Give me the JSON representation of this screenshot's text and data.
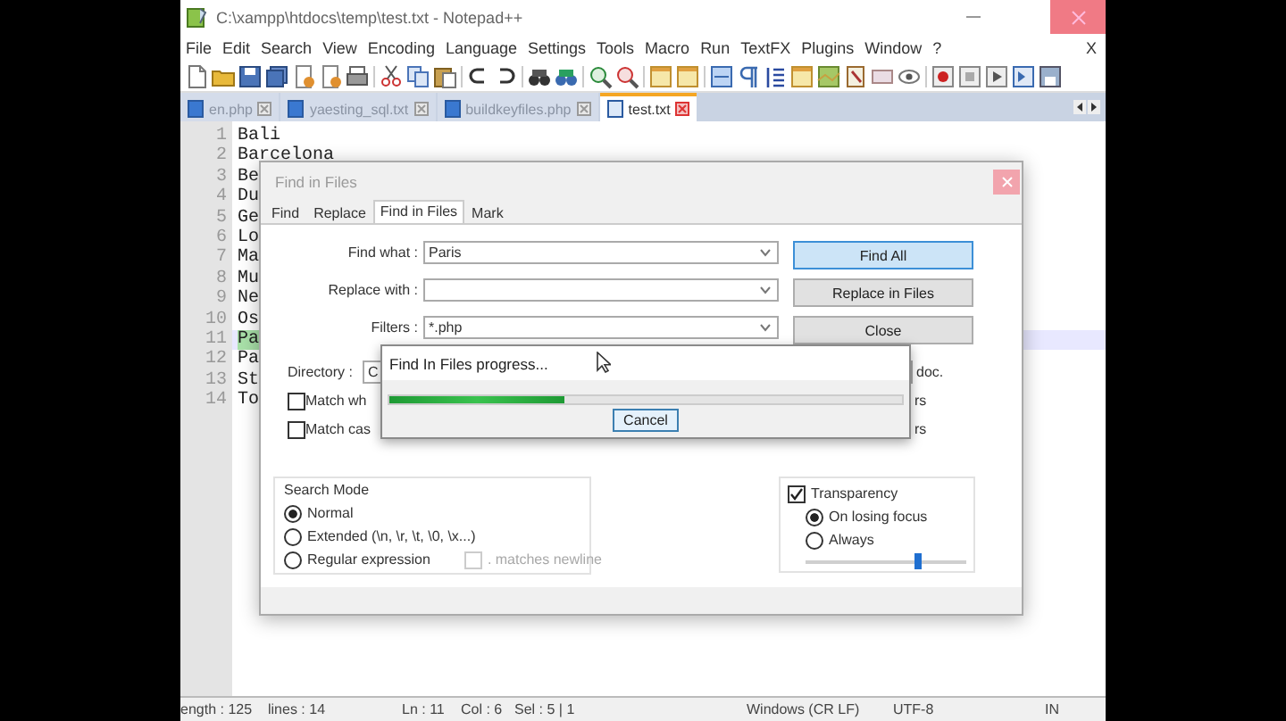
{
  "window": {
    "title": "C:\\xampp\\htdocs\\temp\\test.txt - Notepad++"
  },
  "menu": [
    "File",
    "Edit",
    "Search",
    "View",
    "Encoding",
    "Language",
    "Settings",
    "Tools",
    "Macro",
    "Run",
    "TextFX",
    "Plugins",
    "Window",
    "?"
  ],
  "menu_close": "X",
  "tabs": [
    {
      "label": "en.php",
      "selected": false
    },
    {
      "label": "yaesting_sql.txt",
      "selected": false
    },
    {
      "label": "buildkeyfiles.php",
      "selected": false
    },
    {
      "label": "test.txt",
      "selected": true
    }
  ],
  "editor": {
    "lines": [
      {
        "number": "1",
        "text": "Bali",
        "current": false
      },
      {
        "number": "2",
        "text": "Barcelona",
        "current": false
      },
      {
        "number": "3",
        "text": "Be",
        "current": false
      },
      {
        "number": "4",
        "text": "Du",
        "current": false
      },
      {
        "number": "5",
        "text": "Ge",
        "current": false
      },
      {
        "number": "6",
        "text": "Lo",
        "current": false
      },
      {
        "number": "7",
        "text": "Ma",
        "current": false
      },
      {
        "number": "8",
        "text": "Mu",
        "current": false
      },
      {
        "number": "9",
        "text": "Ne",
        "current": false
      },
      {
        "number": "10",
        "text": "Os",
        "current": false
      },
      {
        "number": "11",
        "text": "Pa",
        "current": true
      },
      {
        "number": "12",
        "text": "Pa",
        "current": false
      },
      {
        "number": "13",
        "text": "St",
        "current": false
      },
      {
        "number": "14",
        "text": "To",
        "current": false
      }
    ]
  },
  "find_dialog": {
    "title": "Find in Files",
    "tabs": [
      {
        "label": "Find",
        "selected": false
      },
      {
        "label": "Replace",
        "selected": false
      },
      {
        "label": "Find in Files",
        "selected": true
      },
      {
        "label": "Mark",
        "selected": false
      }
    ],
    "fields": [
      {
        "label": "Find what :",
        "value": "Paris"
      },
      {
        "label": "Replace with :"
      },
      {
        "label": "Filters :",
        "value": "*.php"
      }
    ],
    "buttons": [
      {
        "label": "Find All",
        "default": true
      },
      {
        "label": "Replace in Files",
        "default": false
      },
      {
        "label": "Close",
        "default": false
      }
    ],
    "directory": {
      "label": "Directory :",
      "value": "C",
      "right_text": "doc."
    },
    "checkboxes": [
      {
        "label": "Match wh",
        "checked": false,
        "right_text": "rs"
      },
      {
        "label": "Match cas",
        "checked": false,
        "right_text": "rs"
      }
    ],
    "search_mode": {
      "title": "Search Mode",
      "options": [
        {
          "label": "Normal",
          "selected": true
        },
        {
          "label": "Extended (\\n, \\r, \\t, \\0, \\x...)",
          "selected": false
        },
        {
          "label": "Regular expression",
          "selected": false
        }
      ],
      "matches_newline": {
        "label": ". matches newline",
        "checked": false,
        "disabled": true
      }
    },
    "transparency": {
      "label": "Transparency",
      "checked": true,
      "options": [
        {
          "label": "On losing focus",
          "selected": true
        },
        {
          "label": "Always",
          "selected": false
        }
      ],
      "level": 0.7
    }
  },
  "progress": {
    "title": "Find In Files progress...",
    "level": 0.34,
    "button": "Cancel"
  },
  "status_bar": [
    "ength : 125",
    "lines : 14",
    "Ln : 11",
    "Col : 6",
    "Sel : 5 | 1",
    "Windows (CR LF)",
    "UTF-8",
    "IN"
  ]
}
